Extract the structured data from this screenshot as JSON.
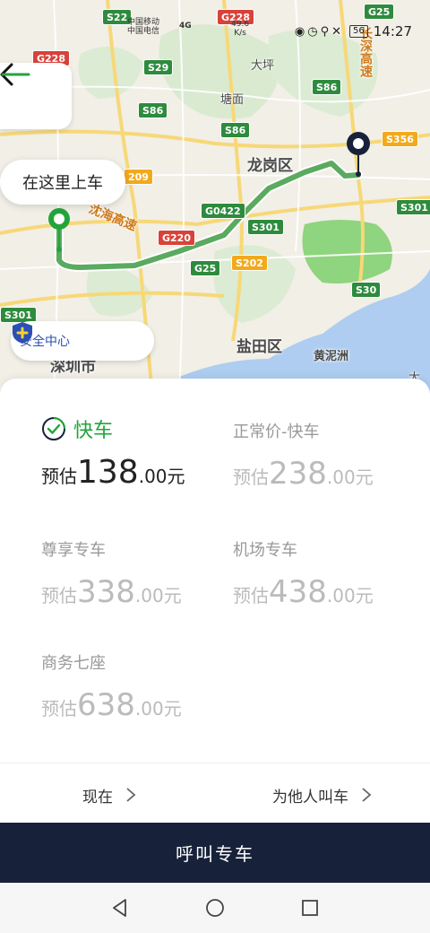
{
  "status_bar": {
    "carrier_line1": "中国移动",
    "carrier_line2": "中国电信",
    "signal_label": "4G",
    "speed_value": "49.6",
    "speed_unit": "K/s",
    "battery": "56",
    "time": "14:27"
  },
  "map": {
    "districts": [
      "龙岗区",
      "盐田区",
      "深圳市",
      "黄泥洲",
      "大坪",
      "塘面",
      "大鹏"
    ],
    "highways": [
      "沈海高速",
      "长深高速"
    ],
    "route_shields": {
      "green": [
        "S22",
        "S29",
        "S86",
        "S86",
        "S86",
        "G25",
        "G25",
        "G0422",
        "S301",
        "S301",
        "S30",
        "S301"
      ],
      "red": [
        "G228",
        "G228",
        "G220"
      ],
      "yellow": [
        "S356",
        "S202",
        "209"
      ]
    },
    "route_color": "#5aaa5f",
    "start_marker_color": "#22a43a",
    "end_marker_color": "#17223a"
  },
  "overlay": {
    "pickup_label": "在这里上车",
    "safety_label": "安全中心"
  },
  "car_options": [
    {
      "name": "快车",
      "prefix": "预估",
      "price_int": "138",
      "price_dec": ".00元",
      "selected": true
    },
    {
      "name": "正常价-快车",
      "prefix": "预估",
      "price_int": "238",
      "price_dec": ".00元",
      "selected": false
    },
    {
      "name": "尊享专车",
      "prefix": "预估",
      "price_int": "338",
      "price_dec": ".00元",
      "selected": false
    },
    {
      "name": "机场专车",
      "prefix": "预估",
      "price_int": "438",
      "price_dec": ".00元",
      "selected": false
    },
    {
      "name": "商务七座",
      "prefix": "预估",
      "price_int": "638",
      "price_dec": ".00元",
      "selected": false
    }
  ],
  "actions": {
    "time_label": "现在",
    "for_others_label": "为他人叫车",
    "call_button": "呼叫专车"
  },
  "colors": {
    "selected_green": "#22a43a",
    "primary_dark": "#17223a",
    "safety_blue": "#2a4fb5"
  }
}
